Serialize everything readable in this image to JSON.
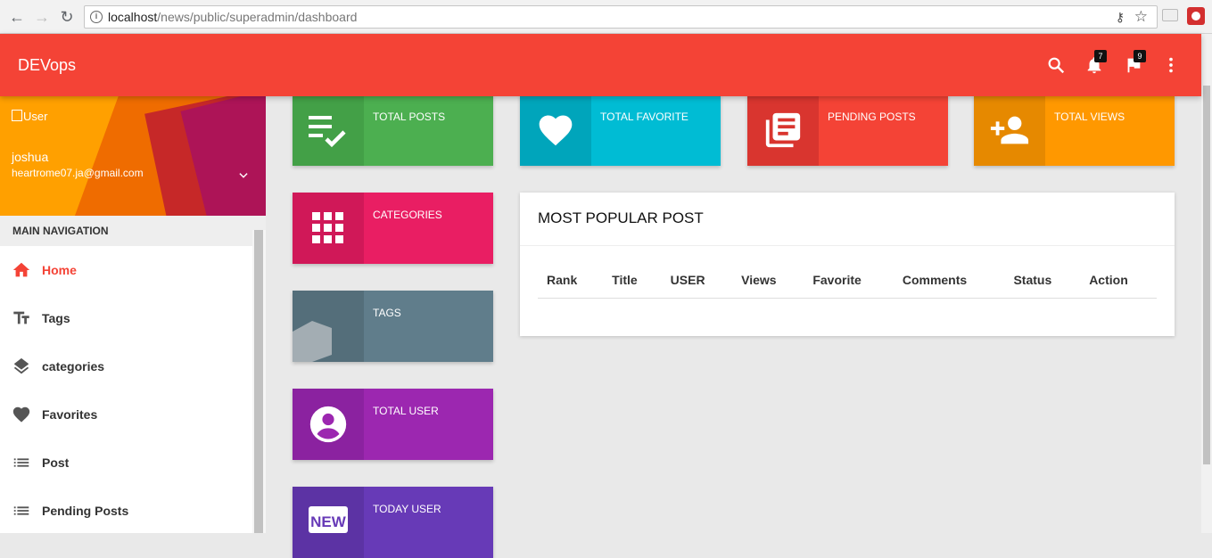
{
  "browser": {
    "url_host": "localhost",
    "url_path": "/news/public/superadmin/dashboard"
  },
  "appbar": {
    "brand": "DEVops",
    "notifications_count": "7",
    "flags_count": "9"
  },
  "user": {
    "image_alt": "User",
    "name": "joshua",
    "email": "heartrome07.ja@gmail.com"
  },
  "nav": {
    "header": "MAIN NAVIGATION",
    "items": [
      {
        "label": "Home",
        "icon": "home-icon",
        "active": true
      },
      {
        "label": "Tags",
        "icon": "text-fields-icon"
      },
      {
        "label": "categories",
        "icon": "layers-icon"
      },
      {
        "label": "Favorites",
        "icon": "heart-icon"
      },
      {
        "label": "Post",
        "icon": "list-icon"
      },
      {
        "label": "Pending Posts",
        "icon": "list-icon"
      }
    ]
  },
  "boxes": {
    "total_posts": {
      "label": "TOTAL POSTS",
      "color": "#4caf50",
      "dark": "#43a047",
      "icon": "playlist-check-icon"
    },
    "total_favorite": {
      "label": "TOTAL FAVORITE",
      "color": "#00bcd4",
      "dark": "#00a5bb",
      "icon": "heart-icon"
    },
    "pending_posts": {
      "label": "PENDING POSTS",
      "color": "#f44336",
      "dark": "#d9352f",
      "icon": "library-books-icon"
    },
    "total_views": {
      "label": "TOTAL VIEWS",
      "color": "#ff9800",
      "dark": "#e68900",
      "icon": "person-add-icon"
    },
    "categories": {
      "label": "CATEGORIES",
      "color": "#e91e63",
      "dark": "#d01858",
      "icon": "apps-grid-icon"
    },
    "tags": {
      "label": "TAGS",
      "color": "#607d8b",
      "dark": "#546e7a",
      "icon": "tag-icon"
    },
    "total_user": {
      "label": "TOTAL USER",
      "color": "#9c27b0",
      "dark": "#8b22a0",
      "icon": "account-circle-icon"
    },
    "today_user": {
      "label": "TODAY USER",
      "color": "#673ab7",
      "dark": "#5c33a4",
      "icon": "new-badge-icon"
    }
  },
  "popular": {
    "title": "MOST POPULAR POST",
    "columns": [
      "Rank",
      "Title",
      "USER",
      "Views",
      "Favorite",
      "Comments",
      "Status",
      "Action"
    ]
  }
}
